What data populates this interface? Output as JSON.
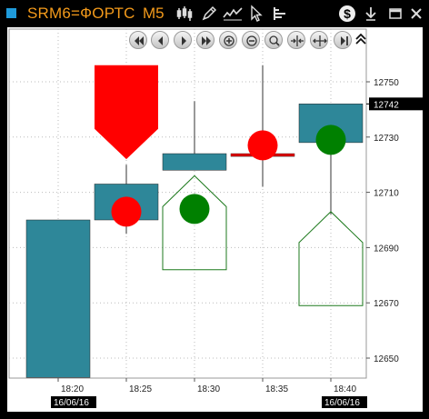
{
  "title_bar": {
    "symbol": "SRM6=ФОРТС",
    "timeframe": "M5",
    "accent_square_color": "#1f9bdb",
    "text_color": "#f39a1b",
    "icons": [
      "bar-chart-icon",
      "pencil-icon",
      "line-chart-icon",
      "cursor-icon",
      "indicators-icon",
      "dollar-icon",
      "download-icon",
      "maximize-icon",
      "close-icon"
    ]
  },
  "nav_toolbar": {
    "buttons": [
      "scroll-to-start-icon",
      "scroll-left-icon",
      "scroll-right-icon",
      "scroll-to-end-icon",
      "zoom-in-icon",
      "zoom-out-icon",
      "zoom-fit-icon",
      "compress-icon",
      "expand-icon",
      "go-to-last-bar-icon",
      "collapse-toolbar-icon"
    ]
  },
  "chart_data": {
    "type": "candlestick",
    "y_ticks": [
      "12750",
      "12730",
      "12710",
      "12690",
      "12670",
      "12650"
    ],
    "x_ticks": [
      "18:20",
      "18:25",
      "18:30",
      "18:35",
      "18:40"
    ],
    "date_labels": [
      "16/06/16",
      "16/06/16"
    ],
    "current_price": "12742",
    "grid": true,
    "candles": [
      {
        "time": "18:20",
        "open": 12700,
        "close": 12643,
        "high": 12700,
        "low": 12643
      },
      {
        "time": "18:25",
        "open": 12700,
        "close": 12713,
        "high": 12720,
        "low": 12695
      },
      {
        "time": "18:30",
        "open": 12718,
        "close": 12724,
        "high": 12743,
        "low": 12718
      },
      {
        "time": "18:35",
        "open": 12723,
        "close": 12724,
        "high": 12756,
        "low": 12712
      },
      {
        "time": "18:40",
        "open": 12728,
        "close": 12742,
        "high": 12742,
        "low": 12702
      }
    ],
    "markers": [
      {
        "kind": "sell-arrow",
        "time": "18:25",
        "top_price": 12756,
        "tip_price": 12722,
        "color": "#ff0000"
      },
      {
        "kind": "buy-arrow-outline",
        "time": "18:30",
        "bottom_price": 12682,
        "tip_price": 12716,
        "color": "#1e7a1e"
      },
      {
        "kind": "buy-arrow-outline",
        "time": "18:40",
        "bottom_price": 12669,
        "tip_price": 12703,
        "color": "#1e7a1e"
      },
      {
        "kind": "sell-dot",
        "time": "18:25",
        "price": 12703,
        "color": "#ff0000"
      },
      {
        "kind": "buy-dot",
        "time": "18:30",
        "price": 12704,
        "color": "#008000"
      },
      {
        "kind": "sell-dot",
        "time": "18:35",
        "price": 12727,
        "color": "#ff0000"
      },
      {
        "kind": "buy-dot",
        "time": "18:40",
        "price": 12729,
        "color": "#008000"
      }
    ],
    "candle_color": "#2e8799",
    "last_trade_line_color": "#cc0000"
  }
}
